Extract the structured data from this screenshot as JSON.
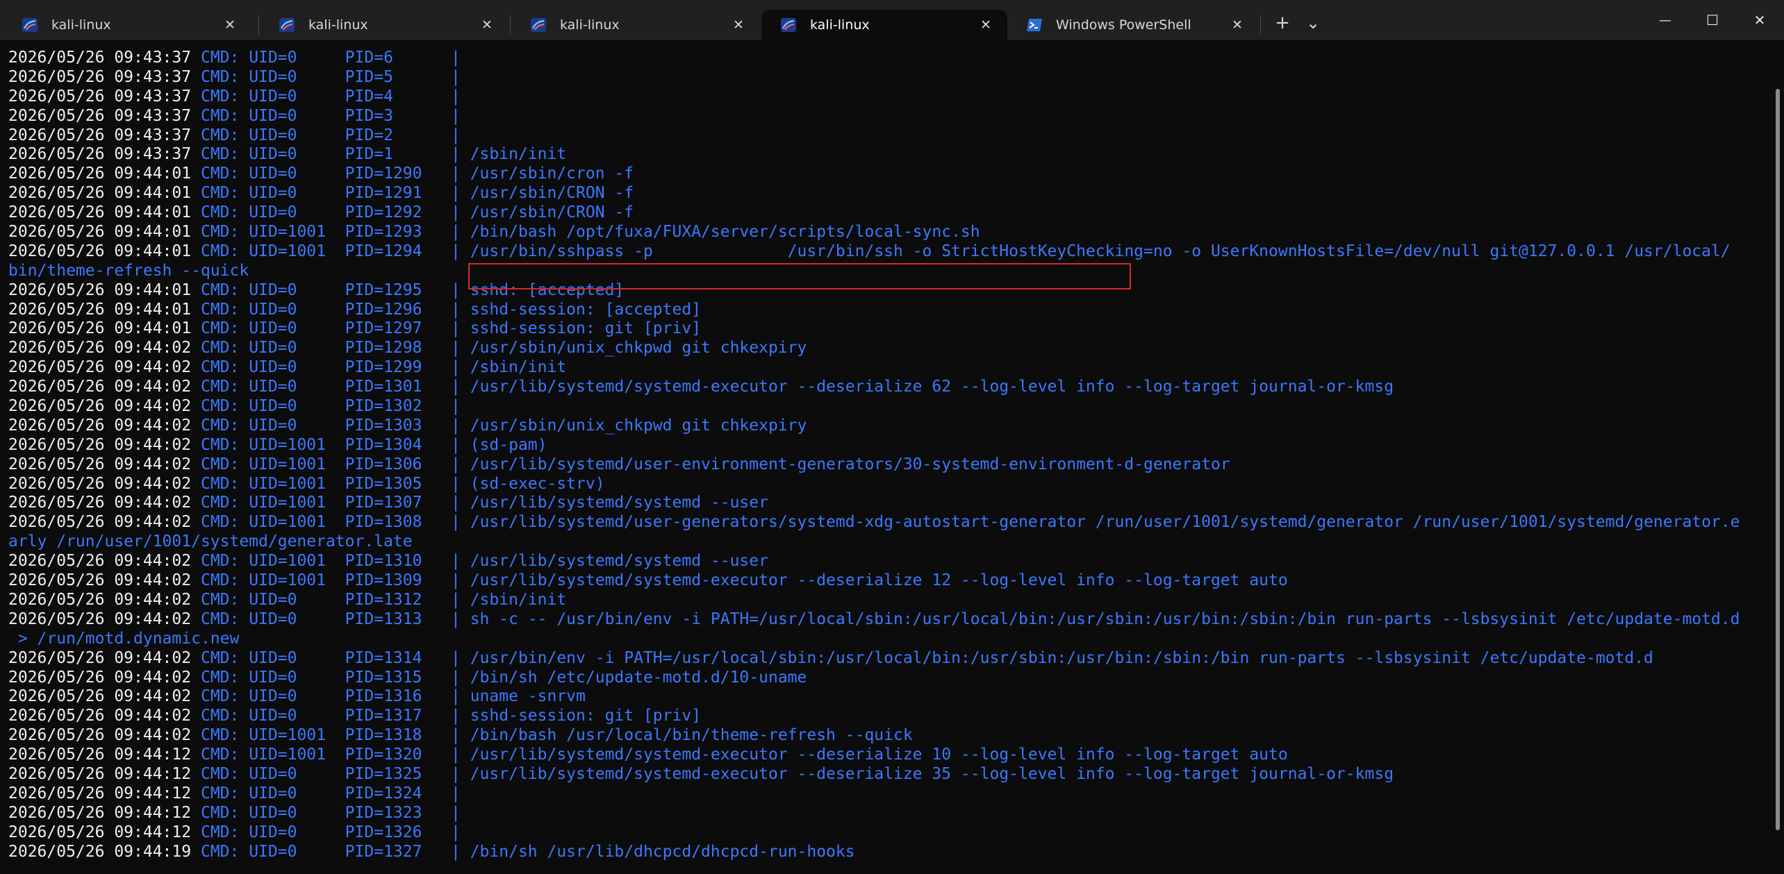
{
  "window": {
    "tabs": [
      {
        "label": "kali-linux",
        "icon": "kali-icon",
        "active": false
      },
      {
        "label": "kali-linux",
        "icon": "kali-icon",
        "active": false
      },
      {
        "label": "kali-linux",
        "icon": "kali-icon",
        "active": false
      },
      {
        "label": "kali-linux",
        "icon": "kali-icon",
        "active": true
      },
      {
        "label": "Windows PowerShell",
        "icon": "powershell-icon",
        "active": false
      }
    ],
    "new_tab_glyph": "+",
    "dropdown_glyph": "⌄",
    "minimize_glyph": "—",
    "maximize_glyph": "☐",
    "close_glyph": "✕",
    "tab_close_glyph": "✕"
  },
  "terminal": {
    "colors": {
      "background": "#0c0c0c",
      "timestamp": "#f0f0f0",
      "blue": "#3b78ff",
      "highlight": "#d42a2a"
    },
    "lines": [
      {
        "ts": "2026/05/26 09:43:37",
        "cmd": "CMD: UID=0     PID=6      ",
        "sep": "|",
        "proc": ""
      },
      {
        "ts": "2026/05/26 09:43:37",
        "cmd": "CMD: UID=0     PID=5      ",
        "sep": "|",
        "proc": ""
      },
      {
        "ts": "2026/05/26 09:43:37",
        "cmd": "CMD: UID=0     PID=4      ",
        "sep": "|",
        "proc": ""
      },
      {
        "ts": "2026/05/26 09:43:37",
        "cmd": "CMD: UID=0     PID=3      ",
        "sep": "|",
        "proc": ""
      },
      {
        "ts": "2026/05/26 09:43:37",
        "cmd": "CMD: UID=0     PID=2      ",
        "sep": "|",
        "proc": ""
      },
      {
        "ts": "2026/05/26 09:43:37",
        "cmd": "CMD: UID=0     PID=1      ",
        "sep": "|",
        "proc": " /sbin/init"
      },
      {
        "ts": "2026/05/26 09:44:01",
        "cmd": "CMD: UID=0     PID=1290   ",
        "sep": "|",
        "proc": " /usr/sbin/cron -f"
      },
      {
        "ts": "2026/05/26 09:44:01",
        "cmd": "CMD: UID=0     PID=1291   ",
        "sep": "|",
        "proc": " /usr/sbin/CRON -f"
      },
      {
        "ts": "2026/05/26 09:44:01",
        "cmd": "CMD: UID=0     PID=1292   ",
        "sep": "|",
        "proc": " /usr/sbin/CRON -f"
      },
      {
        "ts": "2026/05/26 09:44:01",
        "cmd": "CMD: UID=1001  PID=1293   ",
        "sep": "|",
        "proc": " /bin/bash /opt/fuxa/FUXA/server/scripts/local-sync.sh"
      },
      {
        "ts": "2026/05/26 09:44:01",
        "cmd": "CMD: UID=1001  PID=1294   ",
        "sep": "|",
        "proc": " /usr/bin/sshpass -p              /usr/bin/ssh -o StrictHostKeyChecking=no -o UserKnownHostsFile=/dev/null git@127.0.0.1 /usr/local/"
      },
      {
        "wrap": "bin/theme-refresh --quick"
      },
      {
        "ts": "2026/05/26 09:44:01",
        "cmd": "CMD: UID=0     PID=1295   ",
        "sep": "|",
        "proc": " sshd: [accepted]"
      },
      {
        "ts": "2026/05/26 09:44:01",
        "cmd": "CMD: UID=0     PID=1296   ",
        "sep": "|",
        "proc": " sshd-session: [accepted]"
      },
      {
        "ts": "2026/05/26 09:44:01",
        "cmd": "CMD: UID=0     PID=1297   ",
        "sep": "|",
        "proc": " sshd-session: git [priv]"
      },
      {
        "ts": "2026/05/26 09:44:02",
        "cmd": "CMD: UID=0     PID=1298   ",
        "sep": "|",
        "proc": " /usr/sbin/unix_chkpwd git chkexpiry"
      },
      {
        "ts": "2026/05/26 09:44:02",
        "cmd": "CMD: UID=0     PID=1299   ",
        "sep": "|",
        "proc": " /sbin/init"
      },
      {
        "ts": "2026/05/26 09:44:02",
        "cmd": "CMD: UID=0     PID=1301   ",
        "sep": "|",
        "proc": " /usr/lib/systemd/systemd-executor --deserialize 62 --log-level info --log-target journal-or-kmsg"
      },
      {
        "ts": "2026/05/26 09:44:02",
        "cmd": "CMD: UID=0     PID=1302   ",
        "sep": "|",
        "proc": ""
      },
      {
        "ts": "2026/05/26 09:44:02",
        "cmd": "CMD: UID=0     PID=1303   ",
        "sep": "|",
        "proc": " /usr/sbin/unix_chkpwd git chkexpiry"
      },
      {
        "ts": "2026/05/26 09:44:02",
        "cmd": "CMD: UID=1001  PID=1304   ",
        "sep": "|",
        "proc": " (sd-pam)"
      },
      {
        "ts": "2026/05/26 09:44:02",
        "cmd": "CMD: UID=1001  PID=1306   ",
        "sep": "|",
        "proc": " /usr/lib/systemd/user-environment-generators/30-systemd-environment-d-generator"
      },
      {
        "ts": "2026/05/26 09:44:02",
        "cmd": "CMD: UID=1001  PID=1305   ",
        "sep": "|",
        "proc": " (sd-exec-strv)"
      },
      {
        "ts": "2026/05/26 09:44:02",
        "cmd": "CMD: UID=1001  PID=1307   ",
        "sep": "|",
        "proc": " /usr/lib/systemd/systemd --user"
      },
      {
        "ts": "2026/05/26 09:44:02",
        "cmd": "CMD: UID=1001  PID=1308   ",
        "sep": "|",
        "proc": " /usr/lib/systemd/user-generators/systemd-xdg-autostart-generator /run/user/1001/systemd/generator /run/user/1001/systemd/generator.e"
      },
      {
        "wrap": "arly /run/user/1001/systemd/generator.late"
      },
      {
        "ts": "2026/05/26 09:44:02",
        "cmd": "CMD: UID=1001  PID=1310   ",
        "sep": "|",
        "proc": " /usr/lib/systemd/systemd --user"
      },
      {
        "ts": "2026/05/26 09:44:02",
        "cmd": "CMD: UID=1001  PID=1309   ",
        "sep": "|",
        "proc": " /usr/lib/systemd/systemd-executor --deserialize 12 --log-level info --log-target auto"
      },
      {
        "ts": "2026/05/26 09:44:02",
        "cmd": "CMD: UID=0     PID=1312   ",
        "sep": "|",
        "proc": " /sbin/init"
      },
      {
        "ts": "2026/05/26 09:44:02",
        "cmd": "CMD: UID=0     PID=1313   ",
        "sep": "|",
        "proc": " sh -c -- /usr/bin/env -i PATH=/usr/local/sbin:/usr/local/bin:/usr/sbin:/usr/bin:/sbin:/bin run-parts --lsbsysinit /etc/update-motd.d"
      },
      {
        "wrap": " > /run/motd.dynamic.new"
      },
      {
        "ts": "2026/05/26 09:44:02",
        "cmd": "CMD: UID=0     PID=1314   ",
        "sep": "|",
        "proc": " /usr/bin/env -i PATH=/usr/local/sbin:/usr/local/bin:/usr/sbin:/usr/bin:/sbin:/bin run-parts --lsbsysinit /etc/update-motd.d"
      },
      {
        "ts": "2026/05/26 09:44:02",
        "cmd": "CMD: UID=0     PID=1315   ",
        "sep": "|",
        "proc": " /bin/sh /etc/update-motd.d/10-uname"
      },
      {
        "ts": "2026/05/26 09:44:02",
        "cmd": "CMD: UID=0     PID=1316   ",
        "sep": "|",
        "proc": " uname -snrvm"
      },
      {
        "ts": "2026/05/26 09:44:02",
        "cmd": "CMD: UID=0     PID=1317   ",
        "sep": "|",
        "proc": " sshd-session: git [priv]"
      },
      {
        "ts": "2026/05/26 09:44:02",
        "cmd": "CMD: UID=1001  PID=1318   ",
        "sep": "|",
        "proc": " /bin/bash /usr/local/bin/theme-refresh --quick"
      },
      {
        "ts": "2026/05/26 09:44:12",
        "cmd": "CMD: UID=1001  PID=1320   ",
        "sep": "|",
        "proc": " /usr/lib/systemd/systemd-executor --deserialize 10 --log-level info --log-target auto"
      },
      {
        "ts": "2026/05/26 09:44:12",
        "cmd": "CMD: UID=0     PID=1325   ",
        "sep": "|",
        "proc": " /usr/lib/systemd/systemd-executor --deserialize 35 --log-level info --log-target journal-or-kmsg"
      },
      {
        "ts": "2026/05/26 09:44:12",
        "cmd": "CMD: UID=0     PID=1324   ",
        "sep": "|",
        "proc": ""
      },
      {
        "ts": "2026/05/26 09:44:12",
        "cmd": "CMD: UID=0     PID=1323   ",
        "sep": "|",
        "proc": ""
      },
      {
        "ts": "2026/05/26 09:44:12",
        "cmd": "CMD: UID=0     PID=1326   ",
        "sep": "|",
        "proc": ""
      },
      {
        "ts": "2026/05/26 09:44:19",
        "cmd": "CMD: UID=0     PID=1327   ",
        "sep": "|",
        "proc": " /bin/sh /usr/lib/dhcpcd/dhcpcd-run-hooks"
      }
    ]
  }
}
